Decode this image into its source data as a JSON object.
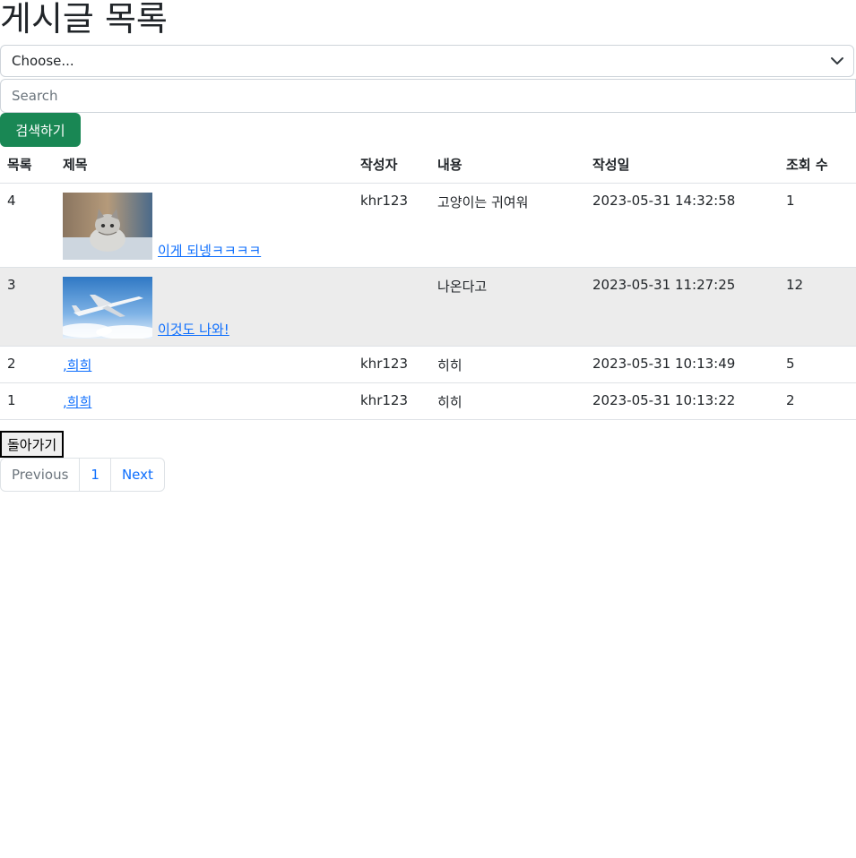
{
  "page": {
    "title": "게시글 목록"
  },
  "filter": {
    "select_value": "Choose...",
    "search_placeholder": "Search",
    "search_button": "검색하기"
  },
  "table": {
    "headers": [
      "목록",
      "제목",
      "작성자",
      "내용",
      "작성일",
      "조회 수"
    ],
    "rows": [
      {
        "no": "4",
        "title": "이게 되넹ㅋㅋㅋㅋ",
        "thumbnail": "kitten-photo",
        "author": "khr123",
        "content": "고양이는 귀여워",
        "date": "2023-05-31 14:32:58",
        "views": "1"
      },
      {
        "no": "3",
        "title": "이것도 나와!",
        "thumbnail": "airplane-photo",
        "author": "",
        "content": "나온다고",
        "date": "2023-05-31 11:27:25",
        "views": "12"
      },
      {
        "no": "2",
        "title": ",희희",
        "thumbnail": "",
        "author": "khr123",
        "content": "히히",
        "date": "2023-05-31 10:13:49",
        "views": "5"
      },
      {
        "no": "1",
        "title": ",희희",
        "thumbnail": "",
        "author": "khr123",
        "content": "히히",
        "date": "2023-05-31 10:13:22",
        "views": "2"
      }
    ]
  },
  "back_button": "돌아가기",
  "pagination": {
    "previous": "Previous",
    "page": "1",
    "next": "Next"
  }
}
